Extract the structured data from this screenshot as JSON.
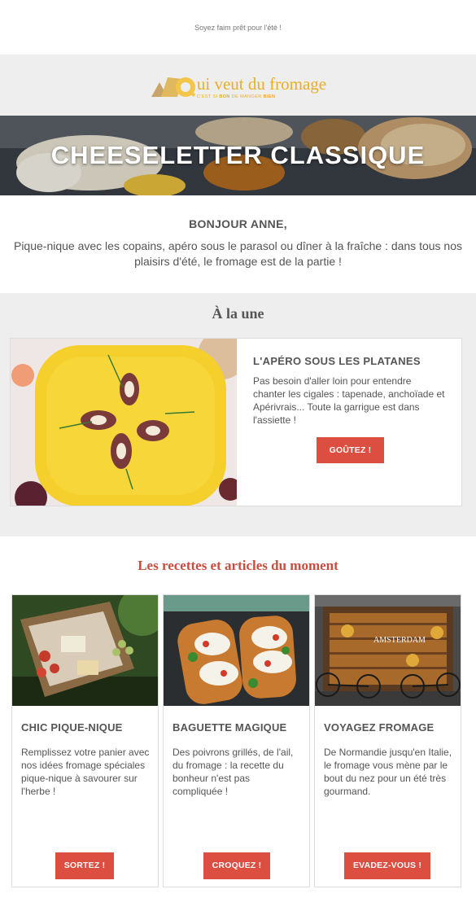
{
  "preheader": "Soyez faim prêt pour l'été !",
  "logo": {
    "title": "ui veut du fromage",
    "subtitle_plain": "C'EST SI ",
    "subtitle_bold": "BON",
    "subtitle_mid": " DE MANGER ",
    "subtitle_end": "BIEN",
    "color": "#e9ae24"
  },
  "hero": {
    "title": "CHEESELETTER CLASSIQUE"
  },
  "intro": {
    "greeting": "BONJOUR ANNE,",
    "text": "Pique-nique avec les copains, apéro sous le parasol ou dîner à la fraîche : dans tous nos plaisirs d'été, le fromage est de la partie !"
  },
  "une": {
    "section_title": "À la une",
    "heading": "L'APÉRO SOUS LES PLATANES",
    "text": "Pas besoin d'aller loin pour entendre chanter les cigales : tapenade, anchoïade et Apérivrais... Toute la garrigue est dans l'assiette !",
    "button": "GOÛTEZ !"
  },
  "recettes": {
    "section_title": "Les recettes et articles du moment",
    "cards": [
      {
        "heading": "CHIC PIQUE-NIQUE",
        "text": "Remplissez votre panier avec nos idées fromage spéciales pique-nique à savourer sur l'herbe !",
        "button": "SORTEZ !"
      },
      {
        "heading": "BAGUETTE MAGIQUE",
        "text": "Des poivrons grillés, de l'ail, du fromage : la recette du bonheur n'est pas compliquée !",
        "button": "CROQUEZ !"
      },
      {
        "heading": "VOYAGEZ FROMAGE",
        "text": "De Normandie jusqu'en Italie, le fromage vous mène par le bout du nez pour un été très gourmand.",
        "button": "EVADEZ-VOUS !",
        "sign": "AMSTERDAM"
      }
    ]
  },
  "colors": {
    "button": "#dc4e3f",
    "section_bg": "#eeeeee",
    "recettes_title": "#c94d3f"
  }
}
